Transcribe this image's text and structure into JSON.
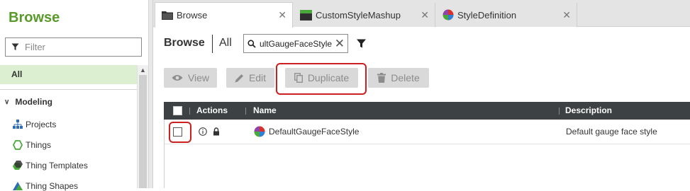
{
  "sidebar": {
    "title": "Browse",
    "filter_placeholder": "Filter",
    "all_label": "All",
    "section": "Modeling",
    "items": [
      {
        "label": "Projects",
        "icon": "projects-icon"
      },
      {
        "label": "Things",
        "icon": "things-icon"
      },
      {
        "label": "Thing Templates",
        "icon": "thing-templates-icon"
      },
      {
        "label": "Thing Shapes",
        "icon": "thing-shapes-icon"
      }
    ]
  },
  "tabs": [
    {
      "label": "Browse",
      "icon": "folder-icon",
      "active": true
    },
    {
      "label": "CustomStyleMashup",
      "icon": "mashup-icon",
      "active": false
    },
    {
      "label": "StyleDefinition",
      "icon": "style-definition-icon",
      "active": false
    }
  ],
  "main": {
    "title": "Browse",
    "scope": "All",
    "search_value": "ultGaugeFaceStyle"
  },
  "toolbar": {
    "view": "View",
    "edit": "Edit",
    "duplicate": "Duplicate",
    "delete": "Delete"
  },
  "grid": {
    "columns": [
      "Actions",
      "Name",
      "Description"
    ],
    "rows": [
      {
        "name": "DefaultGaugeFaceStyle",
        "description": "Default gauge face style",
        "selected": false
      }
    ]
  },
  "colors": {
    "brand_green": "#5a9a2a",
    "highlight_red": "#cc1f1f",
    "grid_header": "#3d4143",
    "selected_nav": "#dcefd0"
  }
}
